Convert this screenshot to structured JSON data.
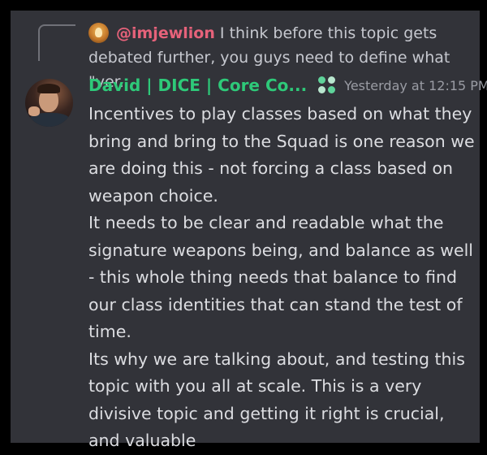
{
  "reply": {
    "username": "@imjewlion",
    "text_line1": "I think before this topic gets",
    "text_line2": "debated further, you guys need to define what \"ver..."
  },
  "message": {
    "author": "David | DICE | Core Co...",
    "timestamp": "Yesterday at 12:15 PM",
    "paragraphs": [
      "Incentives to play classes based on what they bring and bring to the Squad is one reason we are doing this - not forcing a class based on weapon choice.",
      "It needs to be clear and readable what the signature weapons being, and balance as well - this whole thing needs that balance to find our class identities that can stand the test of time.",
      "Its why we are talking about, and testing this topic with you all at scale. This is a very divisive topic and getting it right is crucial, and valuable"
    ]
  },
  "colors": {
    "background": "#323339",
    "author_name": "#2ec979",
    "reply_mention": "#e6627a",
    "body_text": "#dcdde1",
    "timestamp": "#9a9ca4",
    "role_icon_dots": [
      "#5fd39a",
      "#b9e7cf",
      "#b9e7cf",
      "#5fd39a"
    ]
  },
  "icons": {
    "reply_avatar": "lion-avatar",
    "author_avatar": "david-avatar",
    "role_icon": "four-dot-role-icon",
    "reply_connector": "reply-connector-line"
  }
}
